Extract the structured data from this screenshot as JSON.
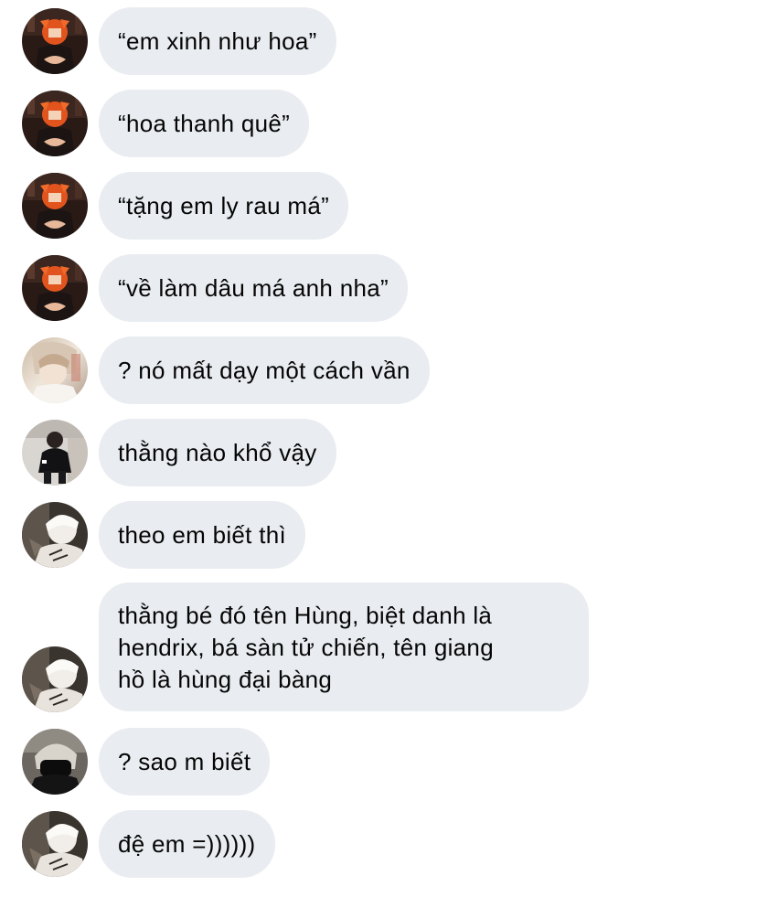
{
  "conversation": {
    "messages": [
      {
        "sender": "avatar-orange",
        "text": "“em xinh như hoa”"
      },
      {
        "sender": "avatar-orange",
        "text": "“hoa thanh quê”"
      },
      {
        "sender": "avatar-orange",
        "text": "“tặng em ly rau má”"
      },
      {
        "sender": "avatar-orange",
        "text": "“về làm dâu má anh nha”"
      },
      {
        "sender": "avatar-light",
        "text": "? nó mất dạy một cách vần"
      },
      {
        "sender": "avatar-dark-jacket",
        "text": "thằng nào khổ vậy"
      },
      {
        "sender": "avatar-white-hair",
        "text": "theo em biết thì"
      },
      {
        "sender": "avatar-white-hair",
        "lines": [
          "thằng bé đó tên Hùng, biệt danh là",
          "hendrix, bá sàn tử chiến, tên giang",
          "hồ là hùng đại bàng"
        ]
      },
      {
        "sender": "avatar-black-mask",
        "text": "? sao m biết"
      },
      {
        "sender": "avatar-white-hair",
        "text": "đệ em =))))))"
      }
    ]
  },
  "colors": {
    "bubble_bg": "#e9ecf0",
    "text": "#050505"
  }
}
